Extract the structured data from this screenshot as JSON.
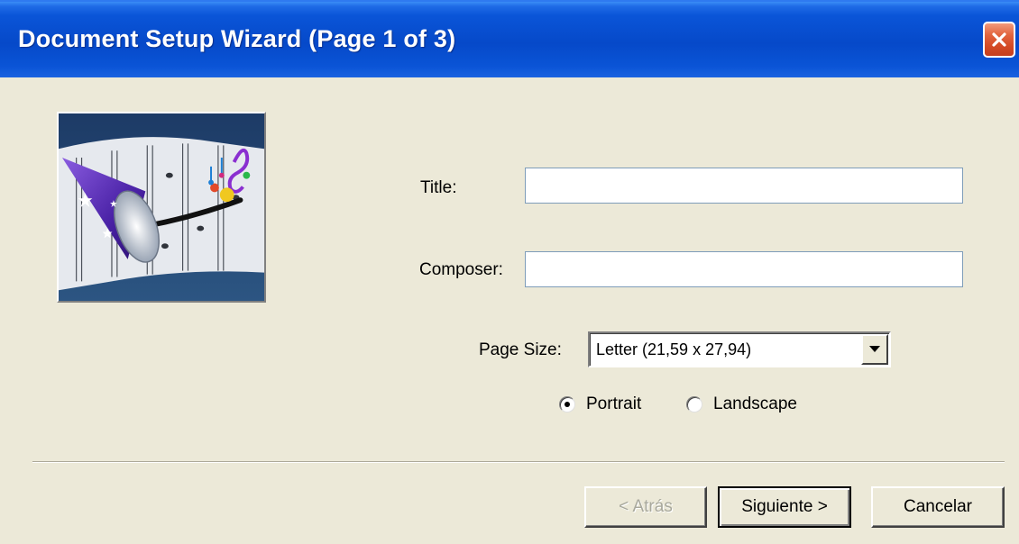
{
  "window": {
    "title": "Document Setup Wizard (Page 1 of 3)",
    "close_icon": "close-icon"
  },
  "colors": {
    "titlebar": "#0a55d8",
    "close_button": "#d44a25",
    "dialog_background": "#ece9d8"
  },
  "form": {
    "title_label": "Title:",
    "title_value": "",
    "composer_label": "Composer:",
    "composer_value": "",
    "page_size_label": "Page Size:",
    "page_size_value": "Letter (21,59 x 27,94)",
    "orientation": {
      "portrait_label": "Portrait",
      "landscape_label": "Landscape",
      "selected": "Portrait"
    }
  },
  "buttons": {
    "back_label": "< Atrás",
    "next_label": "Siguiente >",
    "cancel_label": "Cancelar"
  },
  "icons": {
    "wizard_illustration": "wizard-hat-music-illustration",
    "dropdown_arrow": "chevron-down-icon"
  }
}
